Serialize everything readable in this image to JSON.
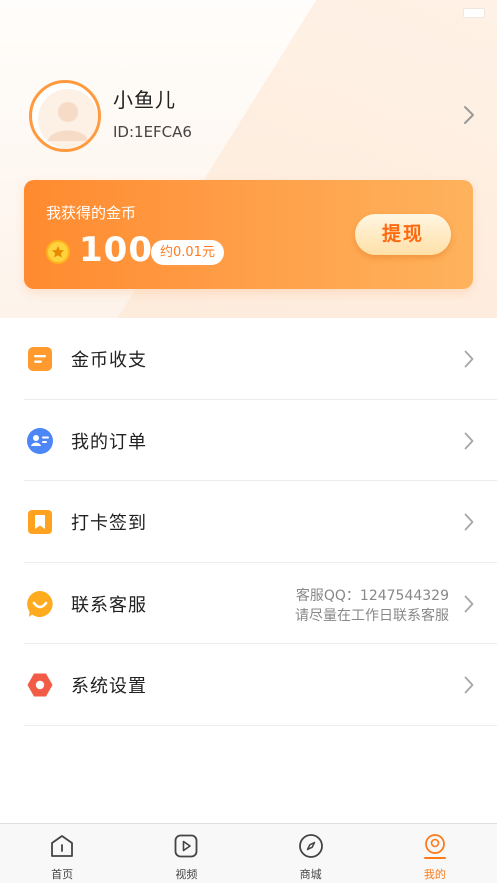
{
  "profile": {
    "nickname": "小鱼儿",
    "user_id": "ID:1EFCA6"
  },
  "coin_card": {
    "title": "我获得的金币",
    "amount": "100",
    "approx": "约0.01元",
    "withdraw_label": "提现"
  },
  "menu": {
    "items": [
      {
        "label": "金币收支",
        "icon": "coin-ledger-icon"
      },
      {
        "label": "我的订单",
        "icon": "order-icon"
      },
      {
        "label": "打卡签到",
        "icon": "bookmark-icon"
      },
      {
        "label": "联系客服",
        "icon": "smile-icon",
        "extra_line1": "客服QQ：1247544329",
        "extra_line2": "请尽量在工作日联系客服"
      },
      {
        "label": "系统设置",
        "icon": "settings-icon"
      }
    ]
  },
  "tabbar": {
    "tabs": [
      {
        "label": "首页",
        "icon": "home-icon"
      },
      {
        "label": "视频",
        "icon": "video-icon"
      },
      {
        "label": "商城",
        "icon": "compass-icon"
      },
      {
        "label": "我的",
        "icon": "profile-icon",
        "active": true
      }
    ]
  },
  "colors": {
    "accent": "#ff7a1a",
    "card_start": "#ff8a2f",
    "card_end": "#ffb25c"
  }
}
